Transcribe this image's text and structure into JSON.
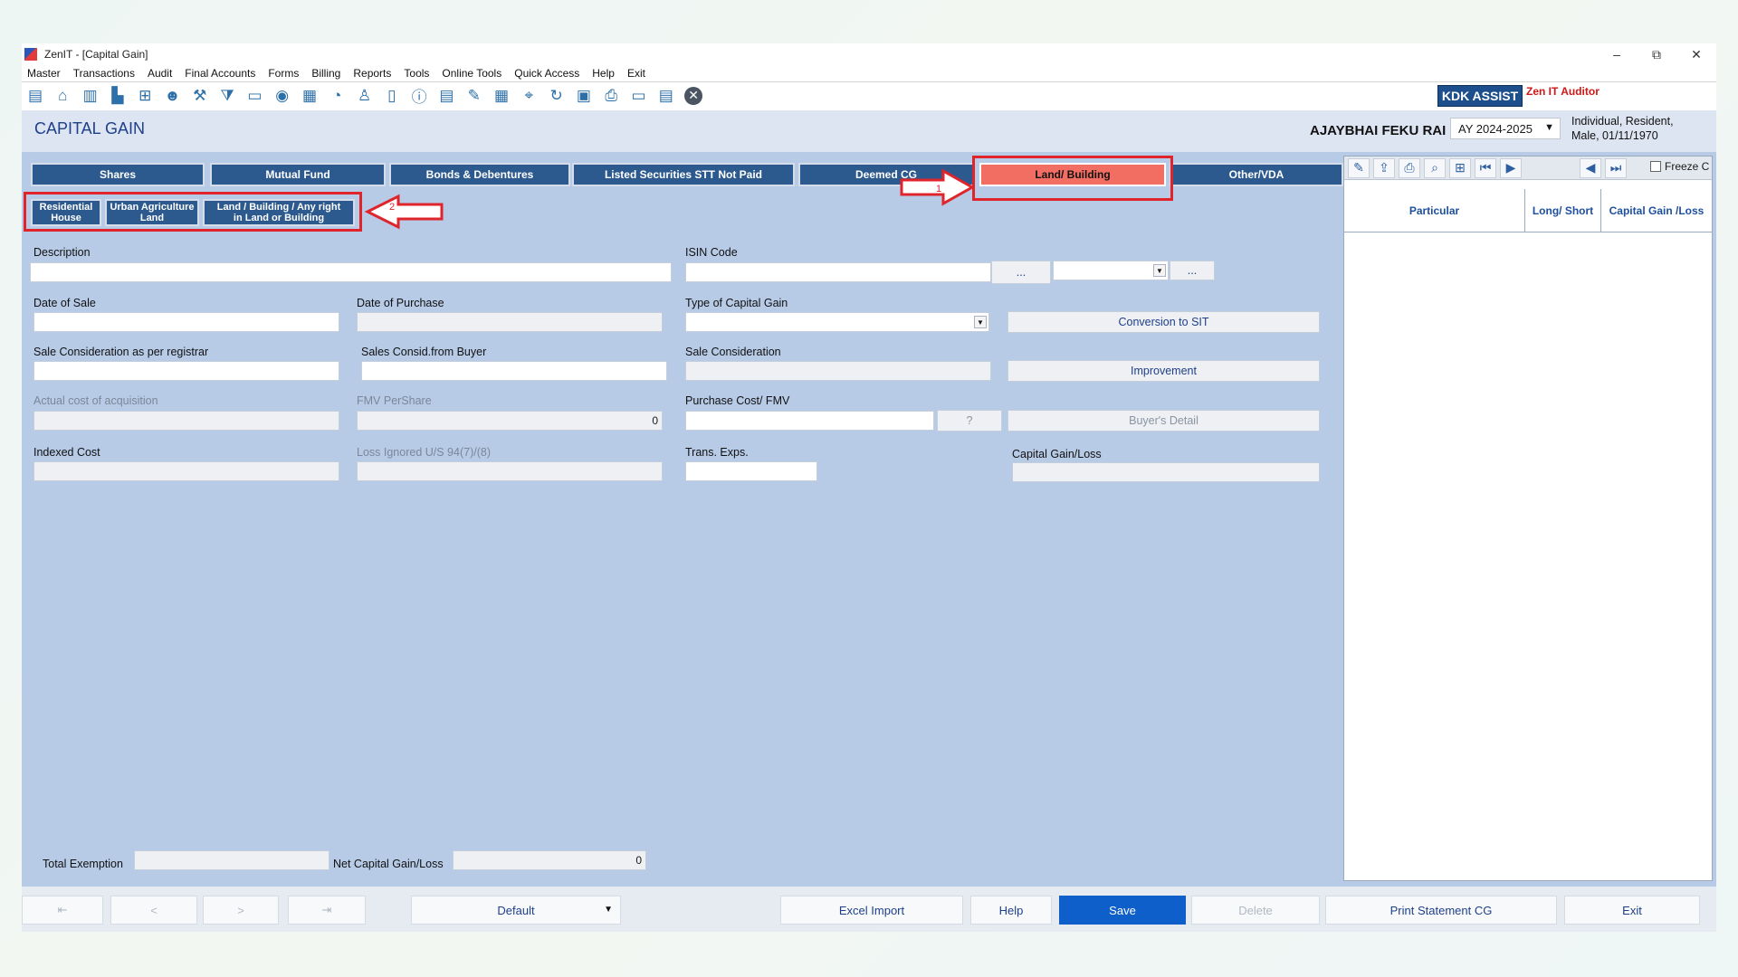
{
  "window": {
    "title": "ZenIT - [Capital Gain]",
    "controls": {
      "minimize": "–",
      "restore": "⧉",
      "close": "✕"
    }
  },
  "menu": [
    {
      "label": "Master"
    },
    {
      "label": "Transactions"
    },
    {
      "label": "Audit"
    },
    {
      "label": "Final Accounts"
    },
    {
      "label": "Forms"
    },
    {
      "label": "Billing"
    },
    {
      "label": "Reports"
    },
    {
      "label": "Tools"
    },
    {
      "label": "Online Tools"
    },
    {
      "label": "Quick Access"
    },
    {
      "label": "Help"
    },
    {
      "label": "Exit"
    }
  ],
  "toolbar_icons": [
    "book-icon",
    "home-icon",
    "building-icon",
    "bar-chart-icon",
    "gift-icon",
    "group-icon",
    "tools-icon",
    "filter-tax-icon",
    "tax-icon",
    "disc-icon",
    "calculator-icon",
    "pie-icon",
    "pay-user-icon",
    "book-open-icon",
    "info-icon",
    "report-icon",
    "document-edit-icon",
    "calendar-icon",
    "location-icon",
    "refresh-icon",
    "balance-sheet-icon",
    "printer-icon",
    "tds-icon",
    "summary-icon",
    "close-circle-icon"
  ],
  "brand": {
    "kdk_assist": "KDK ASSIST",
    "product": "Zen IT Auditor"
  },
  "header": {
    "page_title": "CAPITAL GAIN",
    "person_name": "AJAYBHAI FEKU RAI",
    "assessment_year": "AY 2024-2025",
    "person_info_line1": "Individual, Resident,",
    "person_info_line2": "Male, 01/11/1970"
  },
  "tabs": [
    "Shares",
    "Mutual Fund",
    "Bonds & Debentures",
    "Listed Securities STT Not Paid",
    "Deemed CG",
    "Land/ Building",
    "Other/VDA"
  ],
  "active_tab": "Land/ Building",
  "subtabs": [
    {
      "line1": "Residential",
      "line2": "House"
    },
    {
      "line1": "Urban Agriculture",
      "line2": "Land"
    },
    {
      "line1": "Land / Building / Any right",
      "line2": "in Land or Building"
    }
  ],
  "callouts": {
    "arrow1": "1",
    "arrow2": "2"
  },
  "form": {
    "description_label": "Description",
    "description_value": "",
    "isin_label": "ISIN Code",
    "isin_lookup": "...",
    "isin_extra_button": "...",
    "date_of_sale_label": "Date of Sale",
    "date_of_purchase_label": "Date of Purchase",
    "type_of_cg_label": "Type of Capital Gain",
    "conversion_button": "Conversion to SIT",
    "sale_consid_registrar_label": "Sale Consideration as per registrar",
    "sales_consid_buyer_label": "Sales Consid.from Buyer",
    "sale_consideration_label": "Sale Consideration",
    "improvement_button": "Improvement",
    "actual_cost_label": "Actual cost of acquisition",
    "fmv_per_share_label": "FMV PerShare",
    "fmv_per_share_value": "0",
    "purchase_cost_label": "Purchase Cost/ FMV",
    "purchase_cost_help": "?",
    "buyers_detail_button": "Buyer's Detail",
    "indexed_cost_label": "Indexed Cost",
    "loss_ignored_label": "Loss Ignored U/S 94(7)/(8)",
    "trans_exps_label": "Trans. Exps.",
    "capital_gain_loss_label": "Capital Gain/Loss",
    "total_exemption_label": "Total Exemption",
    "net_cg_label": "Net Capital Gain/Loss",
    "net_cg_value": "0"
  },
  "right_panel": {
    "freeze_label": "Freeze C",
    "columns": [
      "Particular",
      "Long/ Short",
      "Capital Gain /Loss"
    ],
    "icons": [
      "pencil-tools-icon",
      "export-icon",
      "print-icon",
      "search-icon",
      "tree-icon",
      "first-icon",
      "next-icon",
      "prev-page-icon",
      "last-page-icon"
    ]
  },
  "bottom_bar": {
    "nav": [
      "⇤",
      "<",
      ">",
      "⇥"
    ],
    "view_select": "Default",
    "excel_import": "Excel Import",
    "help": "Help",
    "save": "Save",
    "delete": "Delete",
    "print_statement": "Print Statement CG",
    "exit": "Exit"
  },
  "colors": {
    "accent": "#2c5a8e",
    "active_tab": "#f26e63",
    "save": "#0f5fcb",
    "highlight": "#e0242c",
    "panel_bg": "#b7cbe7"
  }
}
